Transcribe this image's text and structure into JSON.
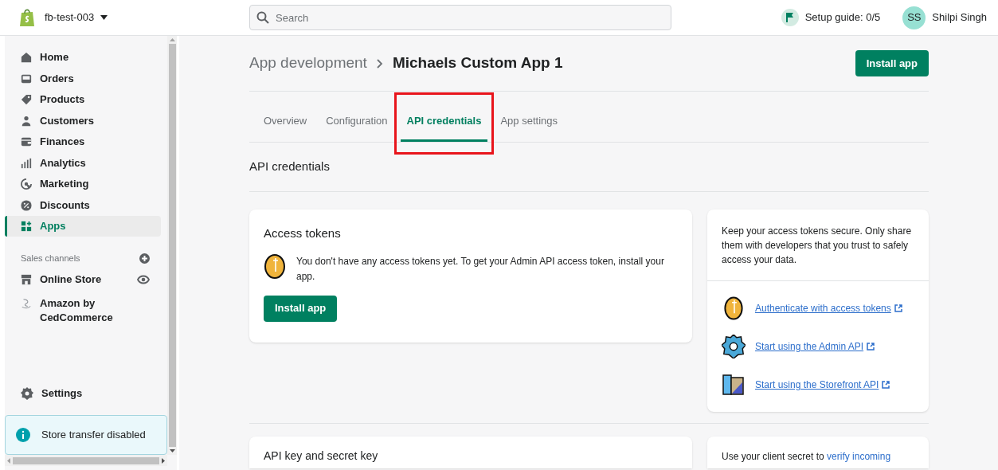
{
  "store": {
    "name": "fb-test-003"
  },
  "search": {
    "placeholder": "Search"
  },
  "setup_guide": {
    "label": "Setup guide: 0/5"
  },
  "user": {
    "initials": "SS",
    "name": "Shilpi Singh"
  },
  "sidebar": {
    "items": [
      {
        "label": "Home",
        "selected": false
      },
      {
        "label": "Orders",
        "selected": false
      },
      {
        "label": "Products",
        "selected": false
      },
      {
        "label": "Customers",
        "selected": false
      },
      {
        "label": "Finances",
        "selected": false
      },
      {
        "label": "Analytics",
        "selected": false
      },
      {
        "label": "Marketing",
        "selected": false
      },
      {
        "label": "Discounts",
        "selected": false
      },
      {
        "label": "Apps",
        "selected": true
      }
    ],
    "sales_channels": {
      "title": "Sales channels",
      "items": [
        {
          "label": "Online Store"
        },
        {
          "label": "Amazon by CedCommerce"
        }
      ]
    },
    "settings": "Settings",
    "notice": "Store transfer disabled"
  },
  "breadcrumb": {
    "parent": "App development",
    "current": "Michaels Custom App 1"
  },
  "primary_action": "Install app",
  "tabs": [
    {
      "label": "Overview",
      "selected": false,
      "highlighted": false
    },
    {
      "label": "Configuration",
      "selected": false,
      "highlighted": false
    },
    {
      "label": "API credentials",
      "selected": true,
      "highlighted": true
    },
    {
      "label": "App settings",
      "selected": false,
      "highlighted": false
    }
  ],
  "section_title": "API credentials",
  "access_tokens": {
    "title": "Access tokens",
    "message": "You don't have any access tokens yet. To get your Admin API access token, install your app.",
    "button": "Install app"
  },
  "tips": {
    "text": "Keep your access tokens secure. Only share them with developers that you trust to safely access your data.",
    "links": [
      {
        "label": "Authenticate with access tokens"
      },
      {
        "label": "Start using the Admin API"
      },
      {
        "label": "Start using the Storefront API"
      }
    ]
  },
  "api_keys": {
    "title": "API key and secret key",
    "note": "Use your client secret to",
    "note_link": "verify incoming"
  }
}
